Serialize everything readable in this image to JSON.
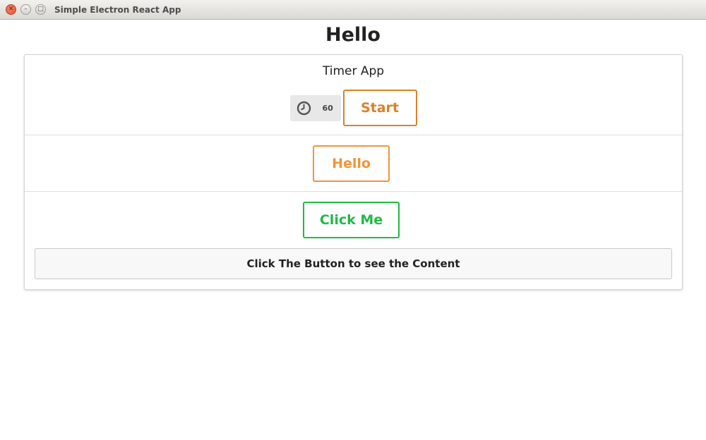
{
  "window": {
    "title": "Simple Electron React App",
    "close_glyph": "✕",
    "minimize_glyph": "–",
    "maximize_glyph": "□"
  },
  "page": {
    "heading": "Hello"
  },
  "timer": {
    "title": "Timer App",
    "icon": "clock-icon",
    "value": "60",
    "start_label": "Start",
    "accent_color": "#d9822b"
  },
  "hello_section": {
    "button_label": "Hello",
    "accent_color": "#f2943a"
  },
  "click_section": {
    "button_label": "Click Me",
    "accent_color": "#21ba45",
    "message": "Click The Button to see the Content"
  }
}
